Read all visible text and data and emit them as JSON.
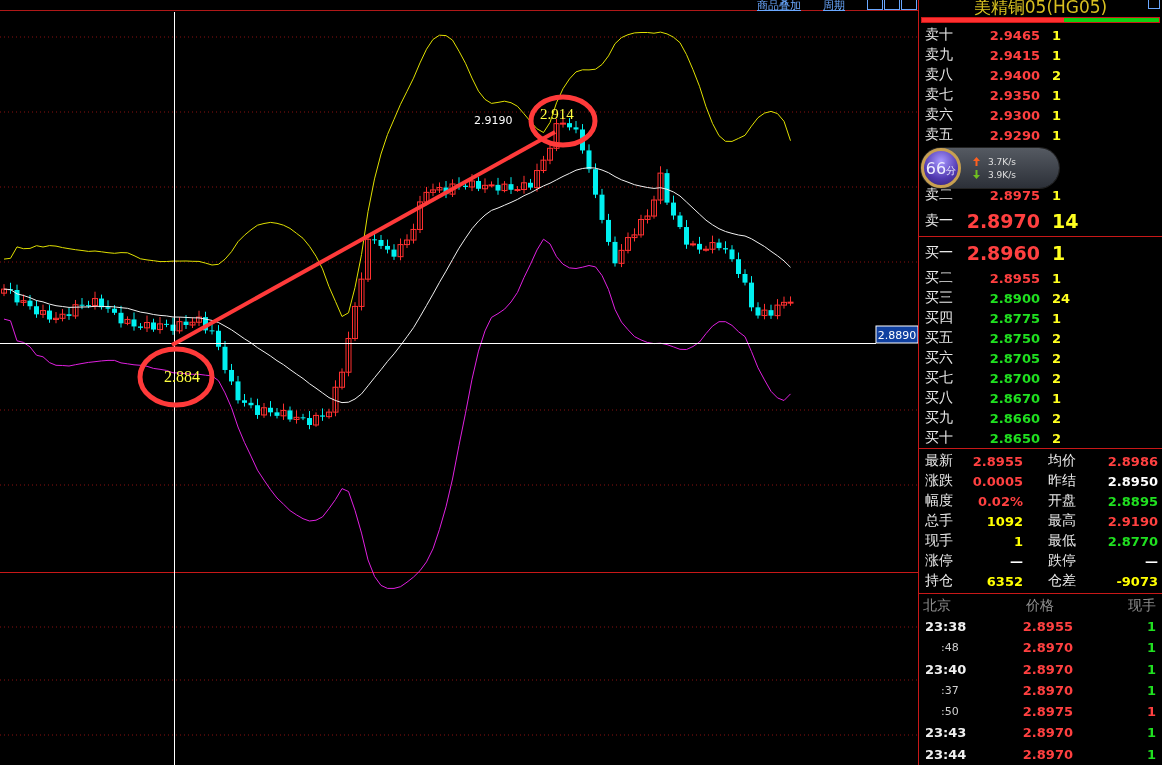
{
  "toolbar": {
    "links": [
      "商品叠加",
      "周期"
    ]
  },
  "chart": {
    "crosshair_price": "2.8890",
    "high_label": "2.9190",
    "annotations": [
      "2.884",
      "2.914"
    ]
  },
  "quote_panel": {
    "title": "美精铜05(HG05)",
    "ratio_bar": {
      "level": 0.6
    },
    "order_book": [
      {
        "kind": "level",
        "label": "卖十",
        "price": "2.9465",
        "volume": "1",
        "color": "#ff4040"
      },
      {
        "kind": "level",
        "label": "卖九",
        "price": "2.9415",
        "volume": "1",
        "color": "#ff4040"
      },
      {
        "kind": "level",
        "label": "卖八",
        "price": "2.9400",
        "volume": "2",
        "color": "#ff4040"
      },
      {
        "kind": "level",
        "label": "卖七",
        "price": "2.9350",
        "volume": "1",
        "color": "#ff4040"
      },
      {
        "kind": "level",
        "label": "卖六",
        "price": "2.9300",
        "volume": "1",
        "color": "#ff4040"
      },
      {
        "kind": "level",
        "label": "卖五",
        "price": "2.9290",
        "volume": "1",
        "color": "#ff4040"
      },
      {
        "kind": "gap"
      },
      {
        "kind": "level",
        "label": "卖二",
        "price": "2.8975",
        "volume": "1",
        "color": "#ff4040"
      },
      {
        "kind": "best",
        "label": "卖一",
        "price": "2.8970",
        "volume": "14",
        "color": "#ff4040"
      },
      {
        "kind": "divider"
      },
      {
        "kind": "best",
        "label": "买一",
        "price": "2.8960",
        "volume": "1",
        "color": "#ff4040"
      },
      {
        "kind": "level",
        "label": "买二",
        "price": "2.8955",
        "volume": "1",
        "color": "#ff4040"
      },
      {
        "kind": "level",
        "label": "买三",
        "price": "2.8900",
        "volume": "24",
        "color": "#20e020"
      },
      {
        "kind": "level",
        "label": "买四",
        "price": "2.8775",
        "volume": "1",
        "color": "#20e020"
      },
      {
        "kind": "level",
        "label": "买五",
        "price": "2.8750",
        "volume": "2",
        "color": "#20e020"
      },
      {
        "kind": "level",
        "label": "买六",
        "price": "2.8705",
        "volume": "2",
        "color": "#20e020"
      },
      {
        "kind": "level",
        "label": "买七",
        "price": "2.8700",
        "volume": "2",
        "color": "#20e020"
      },
      {
        "kind": "level",
        "label": "买八",
        "price": "2.8670",
        "volume": "1",
        "color": "#20e020"
      },
      {
        "kind": "level",
        "label": "买九",
        "price": "2.8660",
        "volume": "2",
        "color": "#20e020"
      },
      {
        "kind": "level",
        "label": "买十",
        "price": "2.8650",
        "volume": "2",
        "color": "#20e020"
      }
    ],
    "speed_widget": {
      "score": "66",
      "unit": "分",
      "upload": "3.7K/s",
      "download": "3.9K/s"
    },
    "stats": [
      {
        "label": "最新",
        "value": "2.8955",
        "color": "#ff4040"
      },
      {
        "label": "均价",
        "value": "2.8986",
        "color": "#ff4040"
      },
      {
        "label": "涨跌",
        "value": "0.0005",
        "color": "#ff4040"
      },
      {
        "label": "昨结",
        "value": "2.8950",
        "color": "#ffffff"
      },
      {
        "label": "幅度",
        "value": "0.02%",
        "color": "#ff4040"
      },
      {
        "label": "开盘",
        "value": "2.8895",
        "color": "#20e020"
      },
      {
        "label": "总手",
        "value": "1092",
        "color": "#ffff00"
      },
      {
        "label": "最高",
        "value": "2.9190",
        "color": "#ff4040"
      },
      {
        "label": "现手",
        "value": "1",
        "color": "#ffff00"
      },
      {
        "label": "最低",
        "value": "2.8770",
        "color": "#20e020"
      },
      {
        "label": "涨停",
        "value": "—",
        "color": "#ffffff"
      },
      {
        "label": "跌停",
        "value": "—",
        "color": "#ffffff"
      },
      {
        "label": "持仓",
        "value": "6352",
        "color": "#ffff00"
      },
      {
        "label": "仓差",
        "value": "-9073",
        "color": "#ffff00"
      }
    ],
    "ticks": {
      "columns": [
        "北京",
        "价格",
        "现手"
      ],
      "rows": [
        {
          "kind": "minute",
          "time": "23:38",
          "price": "2.8955",
          "volume": "1",
          "color": "#20e020"
        },
        {
          "kind": "second",
          "time": ":48",
          "price": "2.8970",
          "volume": "1",
          "color": "#20e020"
        },
        {
          "kind": "minute",
          "time": "23:40",
          "price": "2.8970",
          "volume": "1",
          "color": "#20e020"
        },
        {
          "kind": "second",
          "time": ":37",
          "price": "2.8970",
          "volume": "1",
          "color": "#20e020"
        },
        {
          "kind": "second",
          "time": ":50",
          "price": "2.8975",
          "volume": "1",
          "color": "#ff4040"
        },
        {
          "kind": "minute",
          "time": "23:43",
          "price": "2.8970",
          "volume": "1",
          "color": "#20e020"
        },
        {
          "kind": "minute",
          "time": "23:44",
          "price": "2.8970",
          "volume": "1",
          "color": "#20e020"
        }
      ]
    }
  }
}
